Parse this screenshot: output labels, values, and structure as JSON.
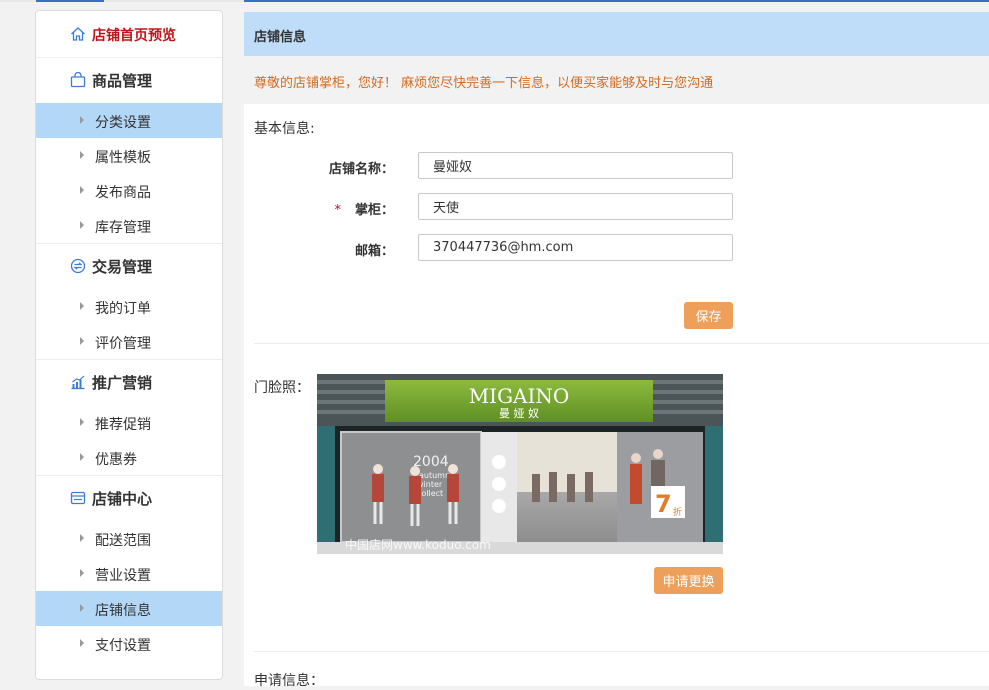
{
  "sidebar": {
    "home": "店铺首页预览",
    "groups": [
      {
        "label": "商品管理",
        "icon": "bag-icon",
        "items": [
          "分类设置",
          "属性模板",
          "发布商品",
          "库存管理"
        ]
      },
      {
        "label": "交易管理",
        "icon": "exchange-icon",
        "items": [
          "我的订单",
          "评价管理"
        ]
      },
      {
        "label": "推广营销",
        "icon": "chart-icon",
        "items": [
          "推荐促销",
          "优惠券"
        ]
      },
      {
        "label": "店铺中心",
        "icon": "store-icon",
        "items": [
          "配送范围",
          "营业设置",
          "店铺信息",
          "支付设置"
        ]
      }
    ],
    "active": [
      "分类设置",
      "店铺信息"
    ]
  },
  "main": {
    "title": "店铺信息",
    "notice": "尊敬的店铺掌柜，您好！ 麻烦您尽快完善一下信息，以便买家能够及时与您沟通",
    "basic": {
      "title": "基本信息:",
      "store_name_label": "店铺名称：",
      "store_name_value": "曼娅奴",
      "keeper_required": "*",
      "keeper_label": "掌柜：",
      "keeper_value": "天使",
      "email_label": "邮箱：",
      "email_value": "370447736@hm.com",
      "save": "保存"
    },
    "photo": {
      "label": "门脸照：",
      "sign_en": "MIGAINO",
      "sign_cn": "曼 娅 奴",
      "window_year": "2004",
      "window_text1": "autumn",
      "window_text2": "winter",
      "window_text3": "collect",
      "promo": "7",
      "promo_sub": "折",
      "watermark": "中国店网www.koduo.com",
      "apply_change": "申请更换"
    },
    "apply_title": "申请信息："
  },
  "colors": {
    "accent_blue": "#b3d8f7",
    "header_blue": "#bfdcf8",
    "button_orange": "#eea05a",
    "notice_orange": "#d46a1f",
    "home_red": "#c0141a"
  }
}
